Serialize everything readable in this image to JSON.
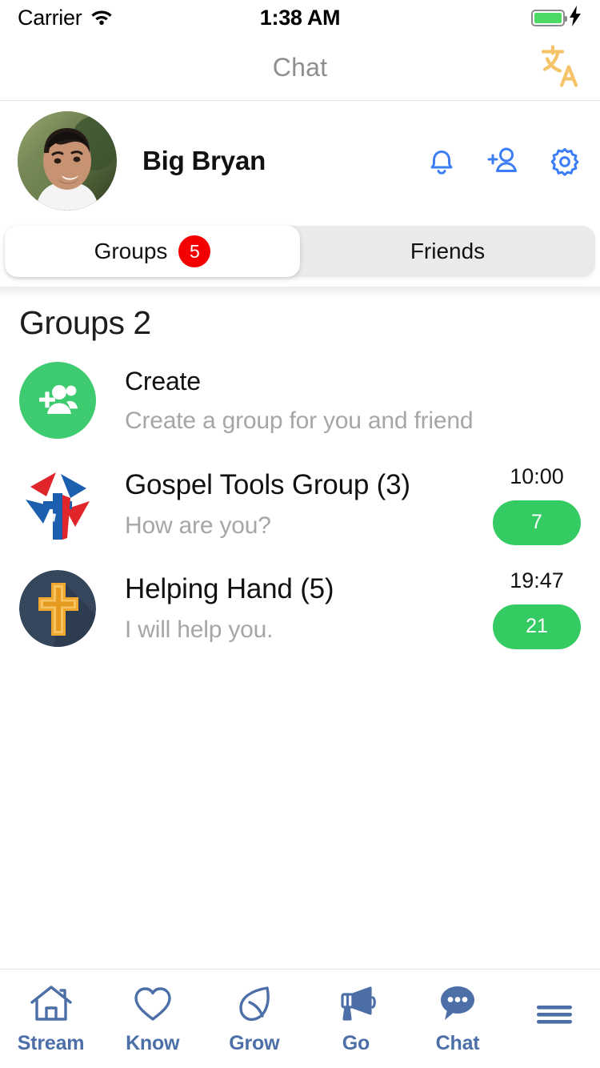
{
  "status_bar": {
    "carrier": "Carrier",
    "wifi_icon": "wifi-icon",
    "time": "1:38 AM",
    "battery_icon": "battery-full-icon",
    "charging_icon": "lightning-bolt-icon",
    "battery_color": "#4cd964"
  },
  "navbar": {
    "title": "Chat",
    "translate_icon": "translate-icon",
    "translate_color": "#f5c468",
    "title_color": "#8e8e93"
  },
  "profile": {
    "name": "Big Bryan",
    "avatar_icon": "user-avatar-photo",
    "actions": [
      {
        "name": "notifications-bell",
        "icon": "bell-icon"
      },
      {
        "name": "add-friend",
        "icon": "person-plus-icon"
      },
      {
        "name": "settings",
        "icon": "gear-icon"
      }
    ],
    "action_color": "#3b7df6"
  },
  "tabs": {
    "items": [
      {
        "label": "Groups",
        "badge": "5",
        "active": true
      },
      {
        "label": "Friends",
        "badge": "",
        "active": false
      }
    ],
    "badge_color": "#f40000"
  },
  "main": {
    "section_title": "Groups 2",
    "rows": [
      {
        "type": "create",
        "icon": "create-group-icon",
        "icon_color": "#3ecb70",
        "title": "Create",
        "subtitle": "Create a group for you and friend",
        "time": "",
        "count": ""
      },
      {
        "type": "group",
        "icon": "gospel-tools-logo",
        "title": "Gospel Tools Group (3)",
        "subtitle": "How are you?",
        "time": "10:00",
        "count": "7"
      },
      {
        "type": "group",
        "icon": "helping-hand-cross-logo",
        "title": "Helping Hand (5)",
        "subtitle": "I will help you.",
        "time": "19:47",
        "count": "21"
      }
    ],
    "count_badge_color": "#34cb63"
  },
  "bottom_nav": {
    "color": "#4d6fa8",
    "items": [
      {
        "label": "Stream",
        "icon": "home-icon",
        "active": false
      },
      {
        "label": "Know",
        "icon": "heart-icon",
        "active": false
      },
      {
        "label": "Grow",
        "icon": "leaf-icon",
        "active": false
      },
      {
        "label": "Go",
        "icon": "megaphone-icon",
        "active": false
      },
      {
        "label": "Chat",
        "icon": "chat-bubble-icon",
        "active": true
      },
      {
        "label": "",
        "icon": "hamburger-menu-icon",
        "active": false
      }
    ]
  }
}
